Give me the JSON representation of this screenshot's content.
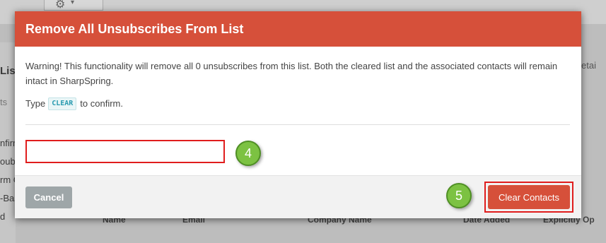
{
  "background": {
    "left_texts": [
      "List",
      "ts",
      "nfirm",
      "ouble",
      "rm C",
      "-Bas",
      "d"
    ],
    "right_texts": [
      "etai"
    ],
    "columns": [
      "Name",
      "Email",
      "Company Name",
      "Date Added",
      "Explicitly Op"
    ]
  },
  "modal": {
    "title": "Remove All Unsubscribes From List",
    "warning": "Warning! This functionality will remove all 0 unsubscribes from this list. Both the cleared list and the associated contacts will remain intact in SharpSpring.",
    "confirm_prefix": "Type",
    "confirm_code": "CLEAR",
    "confirm_suffix": "to confirm.",
    "input_value": "",
    "input_placeholder": "",
    "step_badges": [
      "4",
      "5"
    ],
    "cancel_label": "Cancel",
    "clear_label": "Clear Contacts"
  },
  "colors": {
    "header": "#d6503a",
    "primary_button": "#d6503a",
    "cancel_button": "#9ea6a8",
    "highlight": "#e01d1d",
    "step_badge": "#7cc242"
  },
  "icons": [
    "gear-icon",
    "chevron-down-icon"
  ]
}
